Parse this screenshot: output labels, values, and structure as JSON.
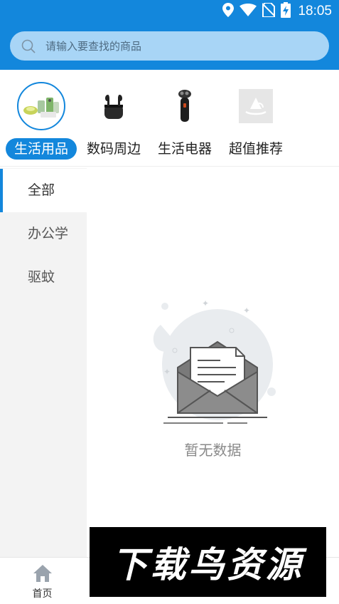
{
  "status_bar": {
    "time": "18:05",
    "icons": [
      "location-icon",
      "wifi-icon",
      "no-sim-icon",
      "battery-charging-icon"
    ]
  },
  "search": {
    "placeholder": "请输入要查找的商品",
    "icon": "search-icon"
  },
  "categories": [
    {
      "label": "生活用品",
      "icon": "daily-goods-image",
      "active": true
    },
    {
      "label": "数码周边",
      "icon": "earbuds-image",
      "active": false
    },
    {
      "label": "生活电器",
      "icon": "shaver-image",
      "active": false
    },
    {
      "label": "超值推荐",
      "icon": "logo-placeholder-image",
      "active": false
    }
  ],
  "sidebar": {
    "items": [
      {
        "label": "全部",
        "active": true
      },
      {
        "label": "办公学",
        "active": false
      },
      {
        "label": "驱蚊",
        "active": false
      }
    ]
  },
  "content": {
    "empty_text": "暂无数据",
    "empty_icon": "empty-envelope-icon"
  },
  "bottom_nav": {
    "items": [
      {
        "label": "首页",
        "icon": "home-icon"
      }
    ]
  },
  "watermark": {
    "text": "下载鸟资源"
  },
  "colors": {
    "primary": "#1387dc",
    "search_bg": "#a8d5f6",
    "sidebar_bg": "#f3f3f3",
    "empty_text": "#8a8a8a"
  }
}
